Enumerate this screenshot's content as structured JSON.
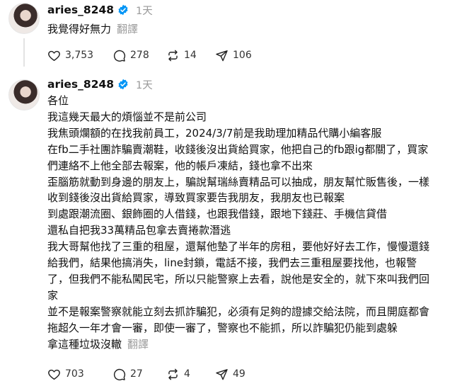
{
  "posts": [
    {
      "username": "aries_8248",
      "time": "1天",
      "text_lines": [
        "我覺得好無力"
      ],
      "translate_label": "翻譯",
      "likes": "3,753",
      "replies": "278",
      "reposts": "14",
      "shares": "106"
    },
    {
      "username": "aries_8248",
      "time": "1天",
      "text_lines": [
        "各位",
        "我這幾天最大的煩惱並不是前公司",
        "我焦頭爛額的在找我前員工，2024/3/7前是我助理加精品代購小編客服",
        "在fb二手社團詐騙賣潮鞋，收錢後沒出貨給買家，他把自己的fb跟ig都關了，買家",
        "們連絡不上他全部去報案，他的帳戶凍結，錢也拿不出來",
        "歪腦筋就動到身邊的朋友上，騙說幫瑞絲賣精品可以抽成，朋友幫忙販售後，一樣",
        "收到錢後沒出貨給買家，導致買家要告我朋友，我朋友也已報案",
        "到處跟潮流圈、銀飾圈的人借錢，也跟我借錢，跟地下錢莊、手機信貸借",
        "還私自把我33萬精品包拿去賣捲款潛逃",
        "我大哥幫他找了三重的租屋，還幫他墊了半年的房租，要他好好去工作，慢慢還錢",
        "給我們，結果他搞消失，line封鎖，電話不接，我們去三重租屋要找他，也報警",
        "了，但我們不能私闖民宅，所以只能警察上去看，說他是安全的，就下來叫我們回",
        "家",
        "並不是報案警察就能立刻去抓詐騙犯，必須有足夠的證據交給法院，而且開庭都會",
        "拖超久一年才會一審，即使一審了，警察也不能抓，所以詐騙犯仍能到處躲",
        "拿這種垃圾沒轍"
      ],
      "translate_label": "翻譯",
      "likes": "703",
      "replies": "27",
      "reposts": "4",
      "shares": "49"
    }
  ],
  "icons": {
    "verified": "verified-badge-icon",
    "like": "heart-icon",
    "reply": "speech-bubble-icon",
    "repost": "repost-arrows-icon",
    "share": "send-paper-plane-icon"
  },
  "colors": {
    "verified": "#0095f6",
    "muted": "#9a9a9a"
  }
}
